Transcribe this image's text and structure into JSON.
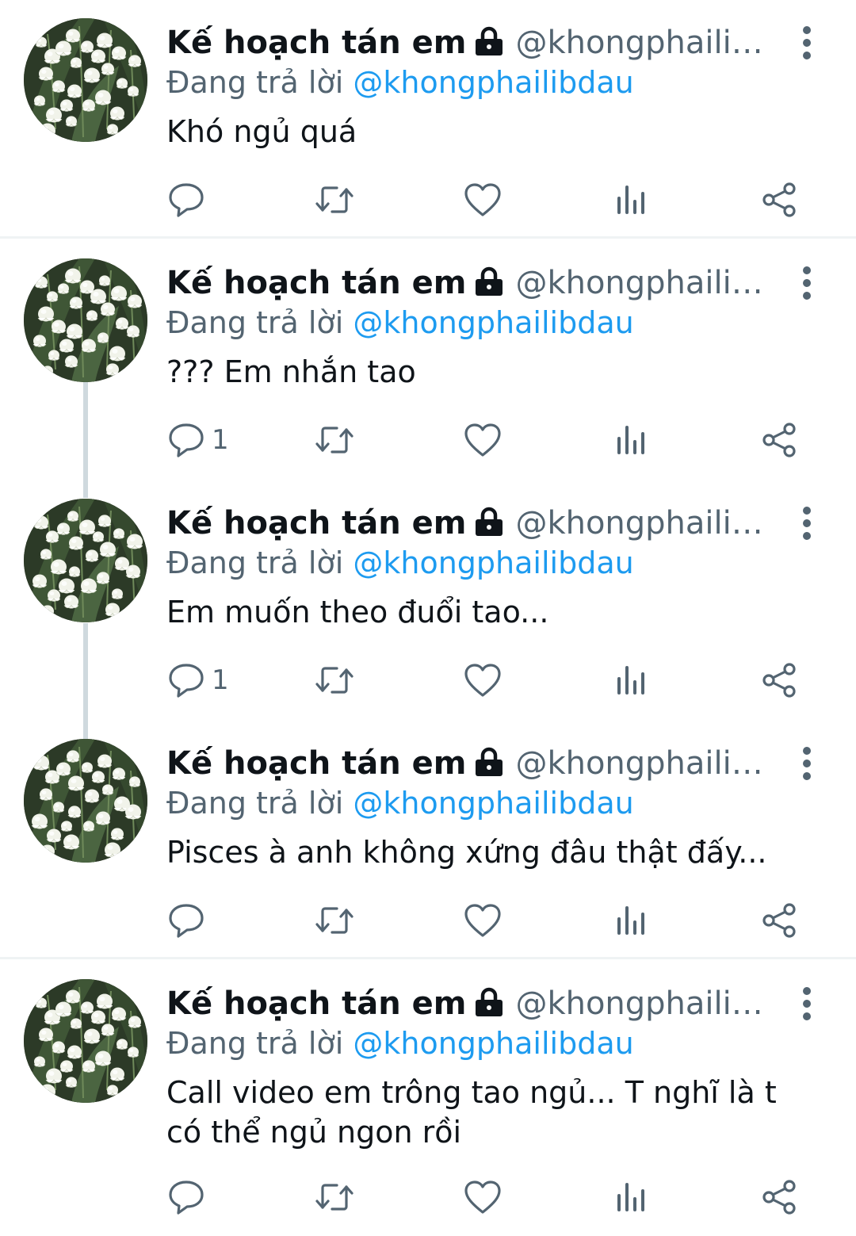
{
  "tweets": [
    {
      "display_name": "Kế hoạch tán em",
      "handle": "@khongphailibdau",
      "reply_prefix": "Đang trả lời",
      "reply_to": "@khongphailibdau",
      "text": "Khó ngủ quá",
      "reply_count": ""
    },
    {
      "display_name": "Kế hoạch tán em",
      "handle": "@khongphailibdau",
      "reply_prefix": "Đang trả lời",
      "reply_to": "@khongphailibdau",
      "text": "??? Em nhắn tao",
      "reply_count": "1"
    },
    {
      "display_name": "Kế hoạch tán em",
      "handle": "@khongphailibdau",
      "reply_prefix": "Đang trả lời",
      "reply_to": "@khongphailibdau",
      "text": "Em muốn theo đuổi tao...",
      "reply_count": "1"
    },
    {
      "display_name": "Kế hoạch tán em",
      "handle": "@khongphailibdau",
      "reply_prefix": "Đang trả lời",
      "reply_to": "@khongphailibdau",
      "text": "Pisces à anh không xứng đâu thật đấy...",
      "reply_count": ""
    },
    {
      "display_name": "Kế hoạch tán em",
      "handle": "@khongphailibdau",
      "reply_prefix": "Đang trả lời",
      "reply_to": "@khongphailibdau",
      "text": "Call video em trông tao ngủ... T nghĩ là t có thể ngủ ngon rồi",
      "reply_count": ""
    }
  ],
  "icons": {
    "lock": "lock-icon",
    "more": "more-vertical-icon",
    "reply": "reply-bubble-icon",
    "retweet": "retweet-icon",
    "like": "heart-icon",
    "views": "views-chart-icon",
    "share": "share-icon"
  },
  "colors": {
    "text_primary": "#0f1419",
    "text_secondary": "#536471",
    "link": "#1d9bf0",
    "thread_line": "#cfd9de",
    "divider": "#eff3f4"
  }
}
